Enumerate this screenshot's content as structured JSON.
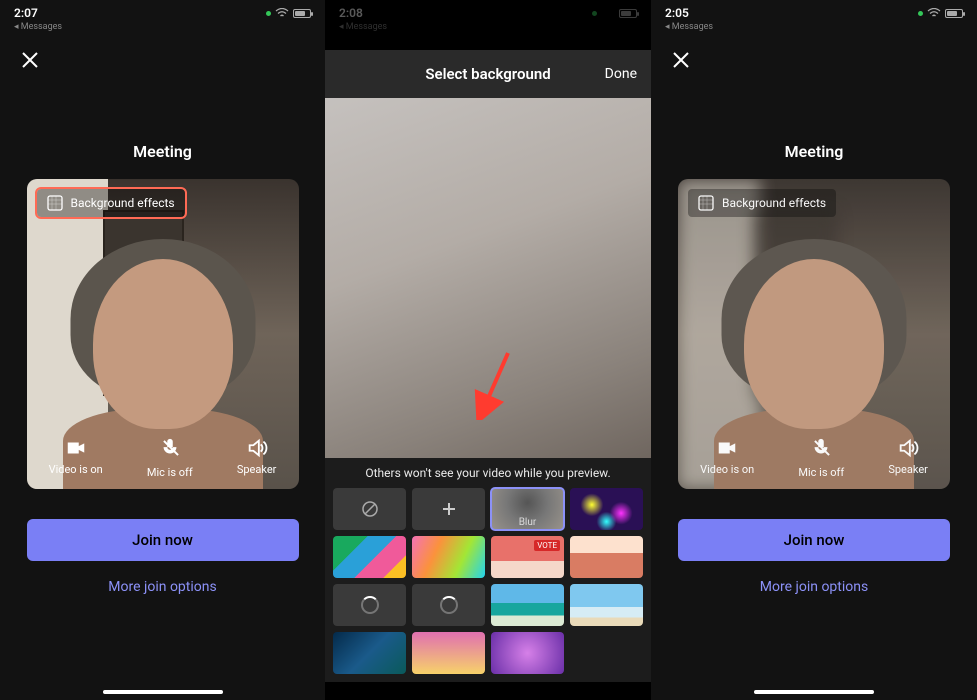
{
  "phoneA": {
    "time": "2:07",
    "crumb": "Messages",
    "title": "Meeting",
    "bg_effects_label": "Background effects",
    "controls": {
      "video": "Video is on",
      "mic": "Mic is off",
      "speaker": "Speaker"
    },
    "join_label": "Join now",
    "more_label": "More join options"
  },
  "phoneB": {
    "time": "2:08",
    "crumb": "Messages",
    "sheet_title": "Select background",
    "done_label": "Done",
    "hint": "Others won't see your video while you preview.",
    "thumbs": {
      "none": "None",
      "add": "Add",
      "blur": "Blur",
      "lights": "Lights",
      "paint1": "Abstract 1",
      "paint2": "Abstract 2",
      "vote": "Vote",
      "curves": "Curves",
      "loading1": "Loading",
      "loading2": "Loading",
      "beach1": "Beach 1",
      "beach2": "Beach 2",
      "aurora": "Aurora",
      "pink": "Sunset",
      "purple": "Nebula"
    },
    "selected": "blur"
  },
  "phoneC": {
    "time": "2:05",
    "crumb": "Messages",
    "title": "Meeting",
    "bg_effects_label": "Background effects",
    "controls": {
      "video": "Video is on",
      "mic": "Mic is off",
      "speaker": "Speaker"
    },
    "join_label": "Join now",
    "more_label": "More join options"
  }
}
